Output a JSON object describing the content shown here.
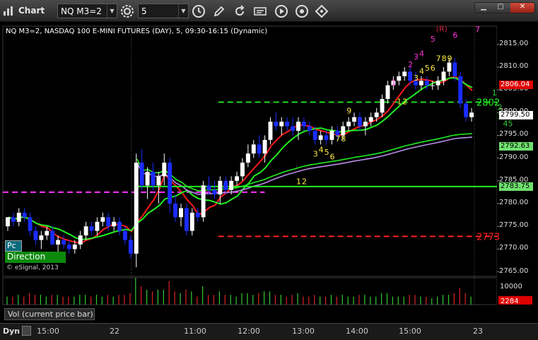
{
  "window": {
    "title": "Chart",
    "symbol_value": "NQ M3=2",
    "interval_value": "5",
    "bottom_label": "Dyn"
  },
  "legend": {
    "title": "NQ M3=2, NASDAQ 100 E-MINI FUTURES (DAY), 5, 09:30-16:15 (Dynamic)",
    "pc_label": "Pc",
    "direction_label": "Direction",
    "copyright": "© eSignal, 2013",
    "volume_label": "Vol (current price bar)"
  },
  "colors": {
    "up_candle": "#ffffff",
    "down_candle": "#1a2cff",
    "green_line": "#22ee22",
    "red_line": "#ff1a1a",
    "purple_line": "#b98ae8",
    "magenta_dash": "#ff33ff",
    "count_up": "#ffee44",
    "count_top": "#ff33dd"
  },
  "chart_data": {
    "type": "candlestick",
    "x_ticks": [
      "15:00",
      "22",
      "11:00",
      "12:00",
      "13:00",
      "14:00",
      "15:00",
      "23"
    ],
    "y_ticks": [
      "2815.00",
      "2810.00",
      "2805.00",
      "2800.00",
      "2795.00",
      "2790.00",
      "2785.00",
      "2780.00",
      "2775.00",
      "2770.00",
      "2765.00"
    ],
    "ylim": [
      2764,
      2819
    ],
    "price_tags": [
      {
        "label": "2806.04",
        "value": 2806.04,
        "bg": "#e00000",
        "fg": "#ffffff"
      },
      {
        "label": "2799.50",
        "value": 2799.5,
        "bg": "#ffffff",
        "fg": "#000000"
      },
      {
        "label": "2792.63",
        "value": 2792.63,
        "bg": "#6fe06f",
        "fg": "#000000"
      },
      {
        "label": "2783.75",
        "value": 2783.75,
        "bg": "#6fe06f",
        "fg": "#000000"
      }
    ],
    "level_labels": [
      {
        "text": "2802",
        "value": 2802.3,
        "color": "#22ee22"
      },
      {
        "text": "2773",
        "value": 2772.8,
        "color": "#ff2222"
      }
    ],
    "dashed_levels": [
      {
        "value": 2802.3,
        "from": 0.25,
        "to": 1.0,
        "color": "#22dd22"
      },
      {
        "value": 2772.8,
        "from": 0.25,
        "to": 1.0,
        "color": "#ff2222"
      },
      {
        "value": 2782.5,
        "from": 0.0,
        "to": 0.53,
        "color": "#ff33ff"
      }
    ],
    "candles": [
      [
        2775,
        2777,
        2774,
        2777
      ],
      [
        2777,
        2778,
        2775,
        2776
      ],
      [
        2776,
        2779,
        2775,
        2778
      ],
      [
        2778,
        2779,
        2776,
        2777
      ],
      [
        2777,
        2778,
        2773,
        2774
      ],
      [
        2774,
        2775,
        2771,
        2772
      ],
      [
        2772,
        2774,
        2770,
        2773
      ],
      [
        2773,
        2775,
        2772,
        2774
      ],
      [
        2774,
        2775,
        2771,
        2771
      ],
      [
        2771,
        2773,
        2769,
        2772
      ],
      [
        2772,
        2773,
        2770,
        2771
      ],
      [
        2771,
        2772,
        2769,
        2770
      ],
      [
        2770,
        2772,
        2769,
        2771
      ],
      [
        2771,
        2774,
        2770,
        2773
      ],
      [
        2773,
        2776,
        2772,
        2775
      ],
      [
        2775,
        2776,
        2773,
        2774
      ],
      [
        2774,
        2777,
        2773,
        2776
      ],
      [
        2776,
        2778,
        2775,
        2777
      ],
      [
        2777,
        2778,
        2774,
        2775
      ],
      [
        2775,
        2777,
        2774,
        2776
      ],
      [
        2776,
        2777,
        2773,
        2774
      ],
      [
        2774,
        2775,
        2771,
        2772
      ],
      [
        2772,
        2773,
        2768,
        2769
      ],
      [
        2769,
        2791,
        2766,
        2789
      ],
      [
        2789,
        2792,
        2783,
        2784
      ],
      [
        2784,
        2788,
        2781,
        2787
      ],
      [
        2787,
        2789,
        2783,
        2784
      ],
      [
        2784,
        2787,
        2780,
        2786
      ],
      [
        2786,
        2791,
        2784,
        2789
      ],
      [
        2789,
        2790,
        2778,
        2780
      ],
      [
        2780,
        2782,
        2776,
        2777
      ],
      [
        2777,
        2780,
        2775,
        2779
      ],
      [
        2779,
        2780,
        2773,
        2774
      ],
      [
        2774,
        2779,
        2773,
        2778
      ],
      [
        2778,
        2779,
        2776,
        2777
      ],
      [
        2777,
        2785,
        2776,
        2784
      ],
      [
        2784,
        2786,
        2782,
        2783
      ],
      [
        2783,
        2785,
        2781,
        2782
      ],
      [
        2782,
        2786,
        2780,
        2785
      ],
      [
        2785,
        2786,
        2782,
        2783
      ],
      [
        2783,
        2786,
        2782,
        2785
      ],
      [
        2785,
        2787,
        2784,
        2786
      ],
      [
        2786,
        2790,
        2785,
        2789
      ],
      [
        2789,
        2793,
        2788,
        2791
      ],
      [
        2791,
        2794,
        2790,
        2793
      ],
      [
        2793,
        2795,
        2790,
        2791
      ],
      [
        2791,
        2795,
        2789,
        2794
      ],
      [
        2794,
        2799,
        2793,
        2798
      ],
      [
        2798,
        2800,
        2796,
        2797
      ],
      [
        2797,
        2799,
        2795,
        2798
      ],
      [
        2798,
        2799,
        2796,
        2797
      ],
      [
        2797,
        2799,
        2795,
        2796
      ],
      [
        2796,
        2799,
        2794,
        2798
      ],
      [
        2798,
        2799,
        2796,
        2797
      ],
      [
        2797,
        2798,
        2795,
        2796
      ],
      [
        2796,
        2797,
        2793,
        2794
      ],
      [
        2794,
        2796,
        2793,
        2795
      ],
      [
        2795,
        2796,
        2793,
        2794
      ],
      [
        2794,
        2797,
        2793,
        2796
      ],
      [
        2796,
        2797,
        2794,
        2795
      ],
      [
        2795,
        2798,
        2794,
        2797
      ],
      [
        2797,
        2799,
        2796,
        2798
      ],
      [
        2798,
        2800,
        2797,
        2799
      ],
      [
        2799,
        2800,
        2796,
        2797
      ],
      [
        2797,
        2799,
        2795,
        2798
      ],
      [
        2798,
        2800,
        2797,
        2799
      ],
      [
        2799,
        2801,
        2798,
        2800
      ],
      [
        2800,
        2804,
        2799,
        2803
      ],
      [
        2803,
        2807,
        2802,
        2806
      ],
      [
        2806,
        2808,
        2805,
        2807
      ],
      [
        2807,
        2809,
        2806,
        2808
      ],
      [
        2808,
        2810,
        2807,
        2809
      ],
      [
        2809,
        2810,
        2806,
        2807
      ],
      [
        2807,
        2809,
        2805,
        2806
      ],
      [
        2806,
        2808,
        2805,
        2807
      ],
      [
        2807,
        2808,
        2805,
        2806
      ],
      [
        2806,
        2807,
        2805,
        2806
      ],
      [
        2806,
        2808,
        2805,
        2807
      ],
      [
        2807,
        2810,
        2806,
        2809
      ],
      [
        2809,
        2812,
        2808,
        2811
      ],
      [
        2811,
        2812,
        2807,
        2808
      ],
      [
        2808,
        2809,
        2801,
        2802
      ],
      [
        2802,
        2803,
        2798,
        2799
      ],
      [
        2799,
        2801,
        2798,
        2800
      ]
    ],
    "volume": {
      "ticks": [
        "10000"
      ],
      "tag": {
        "label": "2284",
        "value": 2284
      },
      "ylim": [
        0,
        14000
      ]
    },
    "count_labels": [
      {
        "text": "1",
        "i": 52,
        "value": 2784.3,
        "color": "#ffee44"
      },
      {
        "text": "2",
        "i": 53,
        "value": 2784.3,
        "color": "#ffee44"
      },
      {
        "text": "3",
        "i": 55,
        "value": 2790.3,
        "color": "#ffee44"
      },
      {
        "text": "4",
        "i": 56,
        "value": 2791.3,
        "color": "#ffee44"
      },
      {
        "text": "5",
        "i": 57,
        "value": 2790.7,
        "color": "#ffee44"
      },
      {
        "text": "6",
        "i": 58,
        "value": 2789.7,
        "color": "#ffee44"
      },
      {
        "text": "7",
        "i": 59,
        "value": 2793.7,
        "color": "#ffee44"
      },
      {
        "text": "8",
        "i": 60,
        "value": 2793.7,
        "color": "#ffee44"
      },
      {
        "text": "9",
        "i": 61,
        "value": 2799.8,
        "color": "#ffee44"
      },
      {
        "text": "1",
        "i": 69,
        "value": 2806.0,
        "color": "#ff33dd"
      },
      {
        "text": "1",
        "i": 70,
        "value": 2801.8,
        "color": "#ffee44"
      },
      {
        "text": "2",
        "i": 71,
        "value": 2801.8,
        "color": "#ffee44"
      },
      {
        "text": "2",
        "i": 72,
        "value": 2810.0,
        "color": "#ff33dd"
      },
      {
        "text": "3",
        "i": 73,
        "value": 2807.0,
        "color": "#ffee44"
      },
      {
        "text": "3",
        "i": 73,
        "value": 2811.7,
        "color": "#ff33dd"
      },
      {
        "text": "4",
        "i": 74,
        "value": 2808.5,
        "color": "#ffee44"
      },
      {
        "text": "4",
        "i": 74,
        "value": 2812.4,
        "color": "#ff33dd"
      },
      {
        "text": "5",
        "i": 75,
        "value": 2809.2,
        "color": "#ffee44"
      },
      {
        "text": "6",
        "i": 76,
        "value": 2809.2,
        "color": "#ffee44"
      },
      {
        "text": "5",
        "i": 76,
        "value": 2815.6,
        "color": "#ff33dd"
      },
      {
        "text": "7",
        "i": 77,
        "value": 2811.3,
        "color": "#ffee44"
      },
      {
        "text": "8",
        "i": 78,
        "value": 2811.3,
        "color": "#ffee44"
      },
      {
        "text": "9",
        "i": 79,
        "value": 2811.3,
        "color": "#ffee44"
      },
      {
        "text": "(R)",
        "i": 77,
        "value": 2817.8,
        "color": "#cc2244"
      },
      {
        "text": "6",
        "i": 80,
        "value": 2816.4,
        "color": "#ff33dd"
      },
      {
        "text": "7",
        "i": 84,
        "value": 2817.7,
        "color": "#ff33dd"
      },
      {
        "text": "1",
        "i": 87,
        "value": 2803.8,
        "color": "#33cc33"
      },
      {
        "text": "2",
        "i": 88,
        "value": 2800.6,
        "color": "#33cc33"
      },
      {
        "text": "3",
        "i": 88,
        "value": 2798.6,
        "color": "#33cc33"
      },
      {
        "text": "45",
        "i": 89,
        "value": 2797.0,
        "color": "#33cc33"
      }
    ]
  }
}
